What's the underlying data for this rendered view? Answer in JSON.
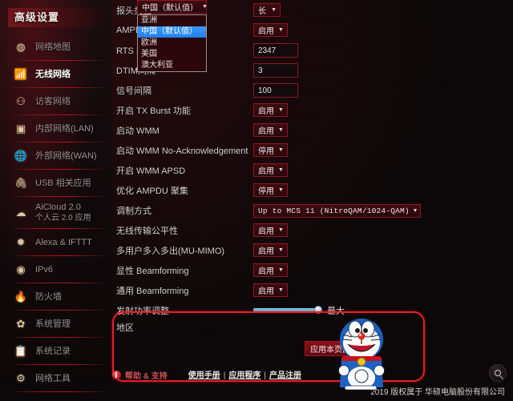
{
  "sidebar": {
    "title": "高级设置",
    "items": [
      {
        "label": "网络地图",
        "icon": "network-map-icon",
        "active": false
      },
      {
        "label": "无线网络",
        "icon": "wireless-icon",
        "active": true
      },
      {
        "label": "访客网络",
        "icon": "guest-network-icon",
        "active": false
      },
      {
        "label": "内部网络(LAN)",
        "icon": "lan-icon",
        "active": false
      },
      {
        "label": "外部网络(WAN)",
        "icon": "wan-globe-icon",
        "active": false
      },
      {
        "label": "USB 相关应用",
        "icon": "usb-icon",
        "active": false
      },
      {
        "label": "AiCloud 2.0",
        "label2": "个人云 2.0 应用",
        "icon": "cloud-icon",
        "active": false
      },
      {
        "label": "Alexa & IFTTT",
        "icon": "alexa-icon",
        "active": false
      },
      {
        "label": "IPv6",
        "icon": "ipv6-globe-icon",
        "active": false
      },
      {
        "label": "防火墙",
        "icon": "firewall-flame-icon",
        "active": false
      },
      {
        "label": "系统管理",
        "icon": "gear-icon",
        "active": false
      },
      {
        "label": "系统记录",
        "icon": "log-icon",
        "active": false
      },
      {
        "label": "网络工具",
        "icon": "tools-gear-icon",
        "active": false
      }
    ]
  },
  "settings": {
    "rows": [
      {
        "label": "报头类型",
        "type": "select",
        "value": "长"
      },
      {
        "label": "AMPDU RTS",
        "type": "select",
        "value": "启用"
      },
      {
        "label": "RTS 门槛设置",
        "type": "text",
        "value": "2347"
      },
      {
        "label": "DTIM间隔",
        "type": "text",
        "value": "3"
      },
      {
        "label": "信号间隔",
        "type": "text",
        "value": "100"
      },
      {
        "label": "开启 TX Burst 功能",
        "type": "select",
        "value": "启用"
      },
      {
        "label": "启动 WMM",
        "type": "select",
        "value": "启用"
      },
      {
        "label": "启动 WMM No-Acknowledgement",
        "type": "select",
        "value": "停用"
      },
      {
        "label": "开启 WMM APSD",
        "type": "select",
        "value": "启用"
      },
      {
        "label": "优化 AMPDU 聚集",
        "type": "select",
        "value": "停用"
      },
      {
        "label": "调制方式",
        "type": "select-wide",
        "value": "Up to MCS 11 (NitroQAM/1024-QAM)"
      },
      {
        "label": "无线传输公平性",
        "type": "select",
        "value": "启用"
      },
      {
        "label": "多用户多入多出(MU-MIMO)",
        "type": "select",
        "value": "启用"
      },
      {
        "label": "显性 Beamforming",
        "type": "select",
        "value": "启用"
      },
      {
        "label": "通用 Beamforming",
        "type": "select",
        "value": "启用"
      },
      {
        "label": "发射功率调整",
        "type": "slider",
        "value": "最大"
      }
    ]
  },
  "region": {
    "label": "地区",
    "selected": "中国（默认值）",
    "options": [
      "亚洲",
      "中国（默认值）",
      "欧洲",
      "美国",
      "澳大利亚"
    ],
    "selected_index": 1
  },
  "apply_button": {
    "label": "应用本页面设置"
  },
  "footer": {
    "help_label": "帮助 & 支持",
    "links": [
      "使用手册",
      "应用程序",
      "产品注册"
    ],
    "separator": "|",
    "copyright": "2019 版权属于 华硕电脑股份有限公司",
    "search_icon": "search-icon"
  },
  "colors": {
    "accent_red": "#8e1620",
    "highlight_red": "#ee1b24",
    "selected_blue": "#2f8bf2",
    "slider_blue": "#6ec6e6"
  }
}
